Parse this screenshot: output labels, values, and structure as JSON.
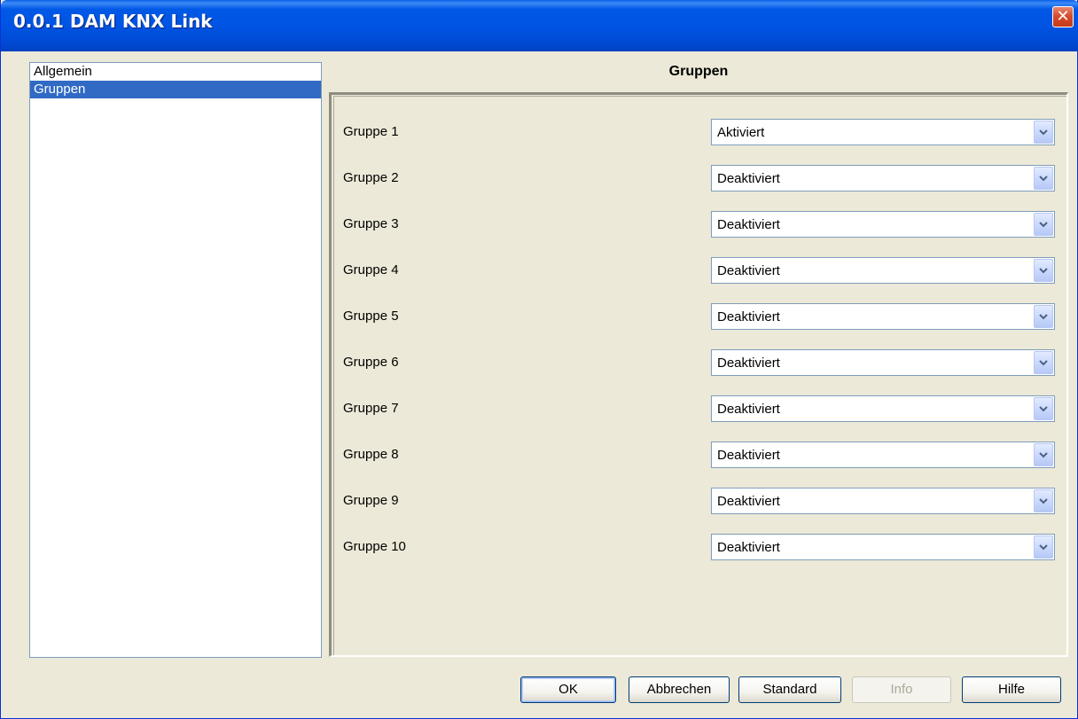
{
  "window": {
    "title": "0.0.1 DAM KNX Link",
    "close_glyph": "✕"
  },
  "sidebar": {
    "items": [
      {
        "label": "Allgemein",
        "selected": false
      },
      {
        "label": "Gruppen",
        "selected": true
      }
    ]
  },
  "main": {
    "title": "Gruppen",
    "rows": [
      {
        "label": "Gruppe 1",
        "value": "Aktiviert"
      },
      {
        "label": "Gruppe 2",
        "value": "Deaktiviert"
      },
      {
        "label": "Gruppe 3",
        "value": "Deaktiviert"
      },
      {
        "label": "Gruppe 4",
        "value": "Deaktiviert"
      },
      {
        "label": "Gruppe 5",
        "value": "Deaktiviert"
      },
      {
        "label": "Gruppe 6",
        "value": "Deaktiviert"
      },
      {
        "label": "Gruppe 7",
        "value": "Deaktiviert"
      },
      {
        "label": "Gruppe 8",
        "value": "Deaktiviert"
      },
      {
        "label": "Gruppe 9",
        "value": "Deaktiviert"
      },
      {
        "label": "Gruppe 10",
        "value": "Deaktiviert"
      }
    ]
  },
  "buttons": {
    "ok": {
      "label": "OK",
      "enabled": true
    },
    "cancel": {
      "label": "Abbrechen",
      "enabled": true
    },
    "standard": {
      "label": "Standard",
      "enabled": true
    },
    "info": {
      "label": "Info",
      "enabled": false
    },
    "help": {
      "label": "Hilfe",
      "enabled": true
    }
  },
  "colors": {
    "titlebar": "#0054e3",
    "selection": "#316ac5",
    "dialog_bg": "#ece9d8",
    "close_button": "#d84b2c"
  }
}
